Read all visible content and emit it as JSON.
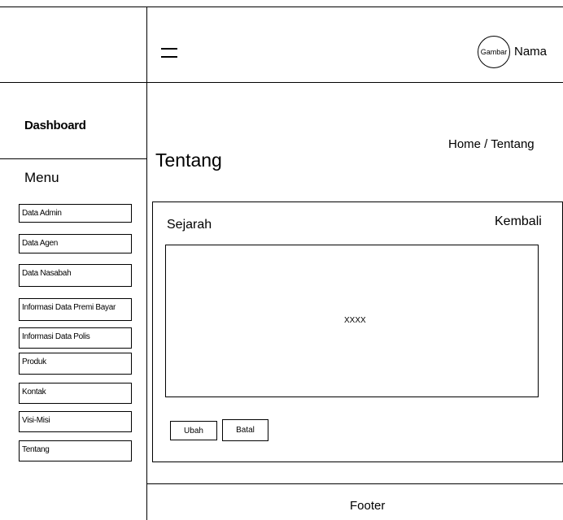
{
  "header": {
    "avatar_text": "Gambar",
    "user_name": "Nama"
  },
  "sidebar": {
    "brand": "Dashboard",
    "menu_title": "Menu",
    "items": [
      {
        "label": "Data Admin"
      },
      {
        "label": "Data Agen"
      },
      {
        "label": "Data Nasabah"
      },
      {
        "label": "Informasi Data Premi Bayar"
      },
      {
        "label": "Informasi Data Polis"
      },
      {
        "label": "Produk"
      },
      {
        "label": "Kontak"
      },
      {
        "label": "Visi-Misi"
      },
      {
        "label": "Tentang"
      }
    ]
  },
  "main": {
    "page_title": "Tentang",
    "breadcrumb": "Home / Tentang",
    "card": {
      "section_title": "Sejarah",
      "back_link": "Kembali",
      "content": "XXXX",
      "edit_button": "Ubah",
      "cancel_button": "Batal"
    }
  },
  "footer": {
    "text": "Footer"
  }
}
